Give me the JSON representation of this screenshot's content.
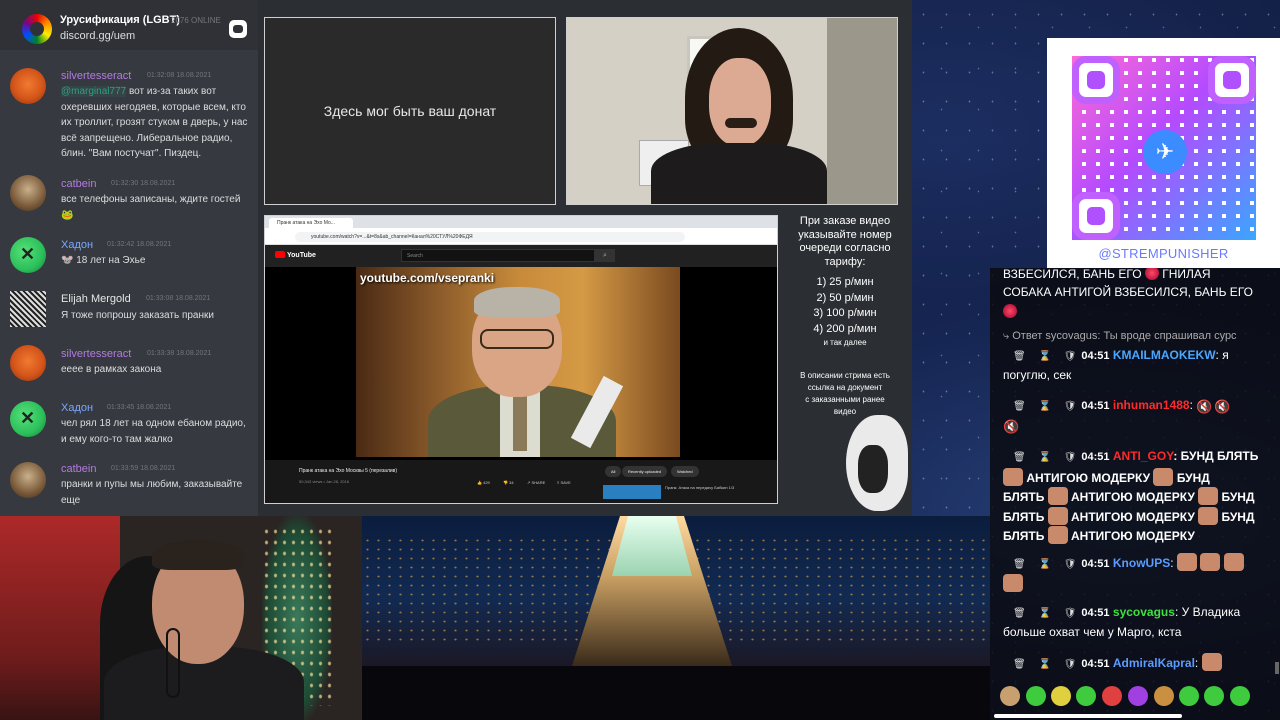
{
  "discord": {
    "server_name": "Урусификация (LGBT)",
    "online": "2076 ONLINE",
    "invite": "discord.gg/uem",
    "messages": [
      {
        "user": "silvertesseract",
        "time": "01:32:08 18.08.2021",
        "mention": "@marginal777",
        "text": " вот из-за таких вот охеревших негодяев, которые всем, кто их троллит, грозят стуком в дверь, у нас всё запрещено. Либеральное радио, блин. \"Вам постучат\". Пиздец."
      },
      {
        "user": "catbein",
        "time": "01:32:30 18.08.2021",
        "text": "все телефоны записаны, ждите гостей"
      },
      {
        "user": "Хадон",
        "time": "01:32:42 18.08.2021",
        "text": "18 лет на Эхье"
      },
      {
        "user": "Elijah Mergold",
        "time": "01:33:08 18.08.2021",
        "text": "Я тоже попрошу заказать пранки"
      },
      {
        "user": "silvertesseract",
        "time": "01:33:38 18.08.2021",
        "text": "ееее в рамках закона"
      },
      {
        "user": "Хадон",
        "time": "01:33:45 18.08.2021",
        "text": "чел рял 18 лет на одном ебаном радио, и ему кого-то там жалко"
      },
      {
        "user": "catbein",
        "time": "01:33:59 18.08.2021",
        "text": "пранки и пупы мы любим, заказывайте еще"
      }
    ]
  },
  "donate_text": "Здесь мог быть ваш донат",
  "video": {
    "tab_title": "Пранк атака на Эхо Мо...",
    "url": "youtube.com/watch?v=...&t=8s&ab_channel=Канал%20СТУЛ%20ФЕДЯ",
    "search_placeholder": "Search",
    "yt_logo": "YouTube",
    "watermark": "youtube.com/vsepranki",
    "title": "Пранк атака на Эхо Москвы 5 (перезалив)",
    "meta": "50,343 views • Jan 28, 2016",
    "likes": "429",
    "dislikes": "34",
    "share": "SHARE",
    "save": "SAVE",
    "chips": [
      "All",
      "Recently uploaded",
      "Watched"
    ],
    "next_title": "Пранк: Атака на передачу Бабкин 1/3"
  },
  "pricing": {
    "header_lines": [
      "При заказе видео",
      "указывайте номер",
      "очереди согласно",
      "тарифу:"
    ],
    "rows": [
      "1) 25 р/мин",
      "2) 50 р/мин",
      "3) 100 р/мин",
      "4) 200 р/мин"
    ],
    "more": "и так далее",
    "desc_lines": [
      "В описании стрима есть",
      "ссылка на документ",
      "с заказанными ранее",
      "видео"
    ]
  },
  "qr_label": "@STREMPUNISHER",
  "twitch_chat": {
    "top_line1": "ВЗБЕСИЛСЯ, БАНЬ ЕГО",
    "top_line1b": "ГНИЛАЯ",
    "top_line2": "СОБАКА АНТИГОЙ ВЗБЕСИЛСЯ, БАНЬ ЕГО",
    "reply": "Ответ sycovagus: Ты вроде спрашивал сурс",
    "badges": "🗑 ⌛ 🛡",
    "lines": [
      {
        "time": "04:51",
        "user": "KMAILMAOKEKW",
        "text": ": я погуглю, сек"
      },
      {
        "time": "04:51",
        "user": "inhuman1488",
        "text": ":"
      },
      {
        "time": "04:51",
        "user": "ANTI_GOY",
        "text": ": БУНД БЛЯТЬ",
        "spam": [
          "АНТИГОЮ МОДЕРКУ",
          "БУНД",
          "БЛЯТЬ",
          "АНТИГОЮ МОДЕРКУ",
          "БУНД",
          "БЛЯТЬ",
          "АНТИГОЮ МОДЕРКУ",
          "БУНД",
          "БЛЯТЬ",
          "АНТИГОЮ МОДЕРКУ"
        ]
      },
      {
        "time": "04:51",
        "user": "KnowUPS",
        "text": ":"
      },
      {
        "time": "04:51",
        "user": "sycovagus",
        "text": ": У Владика больше охват чем у Марго, кста"
      },
      {
        "time": "04:51",
        "user": "AdmiralKapral",
        "text": ":"
      }
    ]
  },
  "colors": {
    "discord_bg": "#36393f",
    "accent_purple": "#b47be0",
    "accent_blue": "#79a8ff",
    "mention": "#2e9e83"
  }
}
